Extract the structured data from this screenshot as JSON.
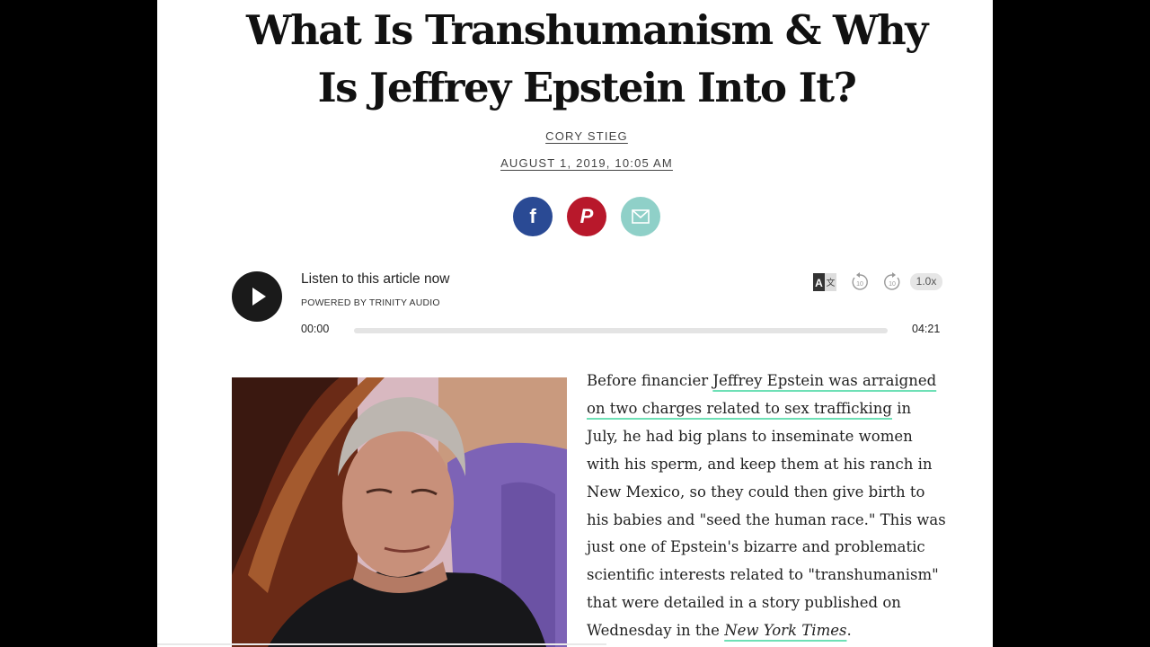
{
  "article": {
    "title_line1": "What Is Transhumanism & Why",
    "title_line2": "Is Jeffrey Epstein Into It?",
    "author": "CORY STIEG",
    "date": "AUGUST 1, 2019, 10:05 AM",
    "body": {
      "before_link": "Before financier ",
      "link1": "Jeffrey Epstein was arraigned on two charges related to sex trafficking",
      "middle": " in July, he had big plans to inseminate women with his sperm, and keep them at his ranch in New Mexico, so they could then give birth to his babies and \"seed the human race.\" This was just one of Epstein's bizarre and problematic scientific interests related to \"transhumanism\" that were detailed in a story published on Wednesday in the ",
      "link2": "New York Times",
      "after": "."
    }
  },
  "share": {
    "facebook_icon": "facebook-icon",
    "pinterest_icon": "pinterest-icon",
    "email_icon": "email-icon",
    "colors": {
      "facebook": "#2a4a94",
      "pinterest": "#b8182b",
      "email": "#8fd0c8"
    }
  },
  "audio_player": {
    "title": "Listen to this article now",
    "powered_by": "POWERED BY  TRINITY AUDIO",
    "current_time": "00:00",
    "duration": "04:21",
    "speed": "1.0x",
    "progress": 0
  }
}
